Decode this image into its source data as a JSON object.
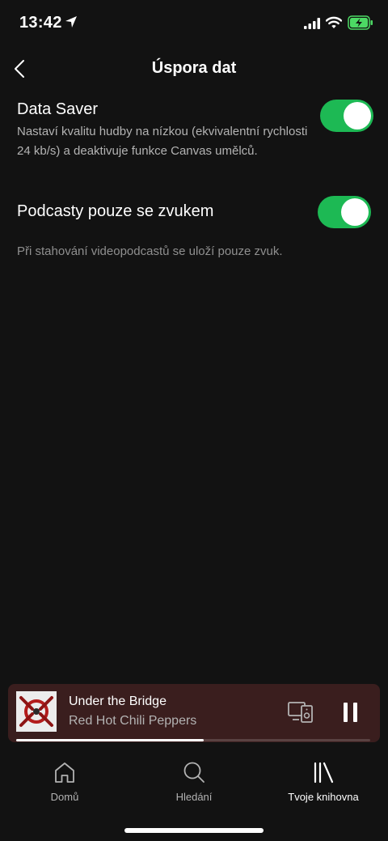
{
  "status": {
    "time": "13:42"
  },
  "header": {
    "title": "Úspora dat"
  },
  "settings": [
    {
      "title": "Data Saver",
      "description": "Nastaví kvalitu hudby na nízkou (ekvivalentní rychlosti 24 kb/s) a deaktivuje funkce Canvas umělců.",
      "enabled": true
    },
    {
      "title": "Podcasty pouze se zvukem",
      "description": "",
      "enabled": true
    }
  ],
  "footnote": "Při stahování videopodcastů se uloží pouze zvuk.",
  "now_playing": {
    "title": "Under the Bridge",
    "artist": "Red Hot Chili Peppers",
    "progress": 0.53
  },
  "tabs": [
    {
      "label": "Domů",
      "icon": "home-icon",
      "active": false
    },
    {
      "label": "Hledání",
      "icon": "search-icon",
      "active": false
    },
    {
      "label": "Tvoje knihovna",
      "icon": "library-icon",
      "active": true
    }
  ],
  "colors": {
    "accent": "#1db954",
    "background": "#121212",
    "player_background": "#3a1e1e"
  }
}
